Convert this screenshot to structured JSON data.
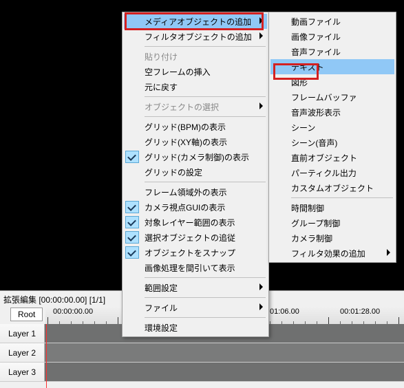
{
  "timeline": {
    "title": "拡張編集 [00:00:00.00] [1/1]",
    "root_label": "Root",
    "times": [
      "00:00:00.00",
      "01:06.00",
      "00:01:28.00"
    ],
    "layers": [
      "Layer 1",
      "Layer 2",
      "Layer 3"
    ]
  },
  "menu1": {
    "items": [
      {
        "label": "メディアオブジェクトの追加",
        "sub": true,
        "hover": true
      },
      {
        "label": "フィルタオブジェクトの追加",
        "sub": true
      },
      "sep",
      {
        "label": "貼り付け",
        "disabled": true
      },
      {
        "label": "空フレームの挿入"
      },
      {
        "label": "元に戻す"
      },
      "sep",
      {
        "label": "オブジェクトの選択",
        "sub": true,
        "disabled": true
      },
      "sep",
      {
        "label": "グリッド(BPM)の表示"
      },
      {
        "label": "グリッド(XY軸)の表示"
      },
      {
        "label": "グリッド(カメラ制御)の表示",
        "checked": true
      },
      {
        "label": "グリッドの設定"
      },
      "sep",
      {
        "label": "フレーム領域外の表示"
      },
      {
        "label": "カメラ視点GUIの表示",
        "checked": true
      },
      {
        "label": "対象レイヤー範囲の表示",
        "checked": true
      },
      {
        "label": "選択オブジェクトの追従",
        "checked": true
      },
      {
        "label": "オブジェクトをスナップ",
        "checked": true
      },
      {
        "label": "画像処理を間引いて表示"
      },
      "sep",
      {
        "label": "範囲設定",
        "sub": true
      },
      "sep",
      {
        "label": "ファイル",
        "sub": true
      },
      "sep",
      {
        "label": "環境設定"
      }
    ]
  },
  "menu2": {
    "items": [
      {
        "label": "動画ファイル"
      },
      {
        "label": "画像ファイル"
      },
      {
        "label": "音声ファイル"
      },
      {
        "label": "テキスト",
        "hover": true
      },
      {
        "label": "図形"
      },
      {
        "label": "フレームバッファ"
      },
      {
        "label": "音声波形表示"
      },
      {
        "label": "シーン"
      },
      {
        "label": "シーン(音声)"
      },
      {
        "label": "直前オブジェクト"
      },
      {
        "label": "パーティクル出力"
      },
      {
        "label": "カスタムオブジェクト"
      },
      "sep",
      {
        "label": "時間制御"
      },
      {
        "label": "グループ制御"
      },
      {
        "label": "カメラ制御"
      },
      {
        "label": "フィルタ効果の追加",
        "sub": true
      }
    ]
  }
}
